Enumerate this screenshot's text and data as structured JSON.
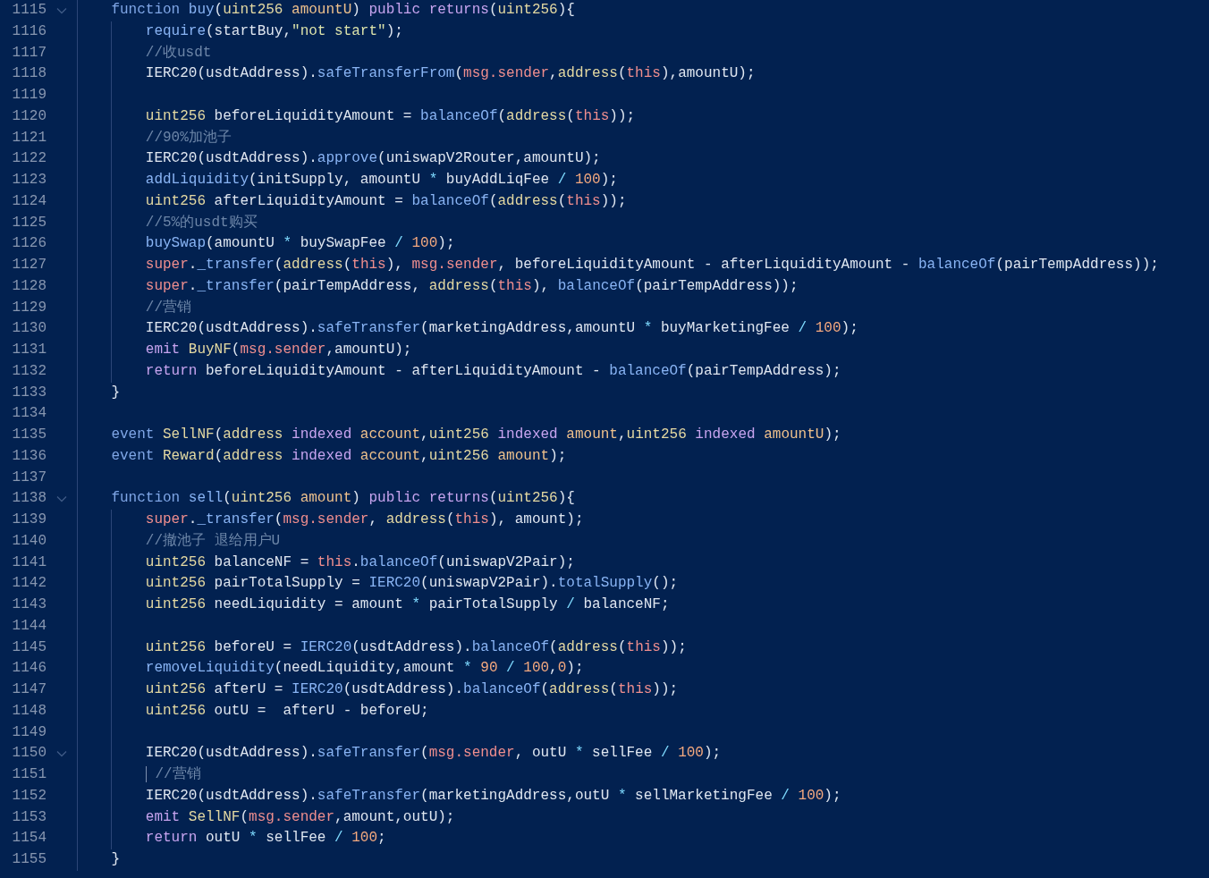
{
  "editor": {
    "lines": [
      {
        "number": "1115",
        "foldable": true,
        "tokens": [
          {
            "kind": "decl",
            "text": "function"
          },
          {
            "kind": "fn",
            "text": " buy"
          },
          {
            "kind": "plain",
            "text": "("
          },
          {
            "kind": "type",
            "text": "uint256"
          },
          {
            "kind": "param",
            "text": " amountU"
          },
          {
            "kind": "plain",
            "text": ") "
          },
          {
            "kind": "kw",
            "text": "public"
          },
          {
            "kind": "kw",
            "text": " returns"
          },
          {
            "kind": "plain",
            "text": "("
          },
          {
            "kind": "type",
            "text": "uint256"
          },
          {
            "kind": "plain",
            "text": "){"
          }
        ],
        "children": [
          {
            "number": "1116",
            "foldable": false,
            "tokens": [
              {
                "kind": "fn",
                "text": "require"
              },
              {
                "kind": "plain",
                "text": "(startBuy,"
              },
              {
                "kind": "str",
                "text": "\"not start\""
              },
              {
                "kind": "plain",
                "text": ");"
              }
            ]
          },
          {
            "number": "1117",
            "foldable": false,
            "tokens": [
              {
                "kind": "comment",
                "text": "//收usdt"
              }
            ]
          },
          {
            "number": "1118",
            "foldable": false,
            "tokens": [
              {
                "kind": "plain",
                "text": "IERC20(usdtAddress)."
              },
              {
                "kind": "fn",
                "text": "safeTransferFrom"
              },
              {
                "kind": "plain",
                "text": "("
              },
              {
                "kind": "self",
                "text": "msg.sender"
              },
              {
                "kind": "plain",
                "text": ","
              },
              {
                "kind": "type",
                "text": "address"
              },
              {
                "kind": "plain",
                "text": "("
              },
              {
                "kind": "self",
                "text": "this"
              },
              {
                "kind": "plain",
                "text": "),amountU);"
              }
            ]
          },
          {
            "number": "1119",
            "foldable": false
          },
          {
            "number": "1120",
            "foldable": false,
            "tokens": [
              {
                "kind": "type",
                "text": "uint256"
              },
              {
                "kind": "plain",
                "text": " beforeLiquidityAmount = "
              },
              {
                "kind": "fn",
                "text": "balanceOf"
              },
              {
                "kind": "plain",
                "text": "("
              },
              {
                "kind": "type",
                "text": "address"
              },
              {
                "kind": "plain",
                "text": "("
              },
              {
                "kind": "self",
                "text": "this"
              },
              {
                "kind": "plain",
                "text": "));"
              }
            ]
          },
          {
            "number": "1121",
            "foldable": false,
            "tokens": [
              {
                "kind": "comment",
                "text": "//90%加池子"
              }
            ]
          },
          {
            "number": "1122",
            "foldable": false,
            "tokens": [
              {
                "kind": "plain",
                "text": "IERC20(usdtAddress)."
              },
              {
                "kind": "fn",
                "text": "approve"
              },
              {
                "kind": "plain",
                "text": "(uniswapV2Router,amountU);"
              }
            ]
          },
          {
            "number": "1123",
            "foldable": false,
            "tokens": [
              {
                "kind": "fn",
                "text": "addLiquidity"
              },
              {
                "kind": "plain",
                "text": "(initSupply, amountU "
              },
              {
                "kind": "op",
                "text": "*"
              },
              {
                "kind": "plain",
                "text": " buyAddLiqFee "
              },
              {
                "kind": "op",
                "text": "/"
              },
              {
                "kind": "num",
                "text": " 100"
              },
              {
                "kind": "plain",
                "text": ");"
              }
            ]
          },
          {
            "number": "1124",
            "foldable": false,
            "tokens": [
              {
                "kind": "type",
                "text": "uint256"
              },
              {
                "kind": "plain",
                "text": " afterLiquidityAmount = "
              },
              {
                "kind": "fn",
                "text": "balanceOf"
              },
              {
                "kind": "plain",
                "text": "("
              },
              {
                "kind": "type",
                "text": "address"
              },
              {
                "kind": "plain",
                "text": "("
              },
              {
                "kind": "self",
                "text": "this"
              },
              {
                "kind": "plain",
                "text": "));"
              }
            ]
          },
          {
            "number": "1125",
            "foldable": false,
            "tokens": [
              {
                "kind": "comment",
                "text": "//5%的usdt购买"
              }
            ]
          },
          {
            "number": "1126",
            "foldable": false,
            "tokens": [
              {
                "kind": "fn",
                "text": "buySwap"
              },
              {
                "kind": "plain",
                "text": "(amountU "
              },
              {
                "kind": "op",
                "text": "*"
              },
              {
                "kind": "plain",
                "text": " buySwapFee "
              },
              {
                "kind": "op",
                "text": "/"
              },
              {
                "kind": "num",
                "text": " 100"
              },
              {
                "kind": "plain",
                "text": ");"
              }
            ]
          },
          {
            "number": "1127",
            "foldable": false,
            "tokens": [
              {
                "kind": "self",
                "text": "super"
              },
              {
                "kind": "plain",
                "text": "."
              },
              {
                "kind": "fn",
                "text": "_transfer"
              },
              {
                "kind": "plain",
                "text": "("
              },
              {
                "kind": "type",
                "text": "address"
              },
              {
                "kind": "plain",
                "text": "("
              },
              {
                "kind": "self",
                "text": "this"
              },
              {
                "kind": "plain",
                "text": "), "
              },
              {
                "kind": "self",
                "text": "msg.sender"
              },
              {
                "kind": "plain",
                "text": ", beforeLiquidityAmount - afterLiquidityAmount - "
              },
              {
                "kind": "fn",
                "text": "balanceOf"
              },
              {
                "kind": "plain",
                "text": "(pairTempAddress));"
              }
            ]
          },
          {
            "number": "1128",
            "foldable": false,
            "tokens": [
              {
                "kind": "self",
                "text": "super"
              },
              {
                "kind": "plain",
                "text": "."
              },
              {
                "kind": "fn",
                "text": "_transfer"
              },
              {
                "kind": "plain",
                "text": "(pairTempAddress, "
              },
              {
                "kind": "type",
                "text": "address"
              },
              {
                "kind": "plain",
                "text": "("
              },
              {
                "kind": "self",
                "text": "this"
              },
              {
                "kind": "plain",
                "text": "), "
              },
              {
                "kind": "fn",
                "text": "balanceOf"
              },
              {
                "kind": "plain",
                "text": "(pairTempAddress));"
              }
            ]
          },
          {
            "number": "1129",
            "foldable": false,
            "tokens": [
              {
                "kind": "comment",
                "text": "//营销"
              }
            ]
          },
          {
            "number": "1130",
            "foldable": false,
            "tokens": [
              {
                "kind": "plain",
                "text": "IERC20(usdtAddress)."
              },
              {
                "kind": "fn",
                "text": "safeTransfer"
              },
              {
                "kind": "plain",
                "text": "(marketingAddress,amountU "
              },
              {
                "kind": "op",
                "text": "*"
              },
              {
                "kind": "plain",
                "text": " buyMarketingFee "
              },
              {
                "kind": "op",
                "text": "/"
              },
              {
                "kind": "num",
                "text": " 100"
              },
              {
                "kind": "plain",
                "text": ");"
              }
            ]
          },
          {
            "number": "1131",
            "foldable": false,
            "tokens": [
              {
                "kind": "kw",
                "text": "emit"
              },
              {
                "kind": "type",
                "text": " BuyNF"
              },
              {
                "kind": "plain",
                "text": "("
              },
              {
                "kind": "self",
                "text": "msg.sender"
              },
              {
                "kind": "plain",
                "text": ",amountU);"
              }
            ]
          },
          {
            "number": "1132",
            "foldable": false,
            "tokens": [
              {
                "kind": "kw",
                "text": "return"
              },
              {
                "kind": "plain",
                "text": " beforeLiquidityAmount - afterLiquidityAmount - "
              },
              {
                "kind": "fn",
                "text": "balanceOf"
              },
              {
                "kind": "plain",
                "text": "(pairTempAddress);"
              }
            ]
          }
        ]
      },
      {
        "number": "1133",
        "foldable": false,
        "tokens": [
          {
            "kind": "plain",
            "text": "}"
          }
        ]
      },
      {
        "number": "1134",
        "foldable": false
      },
      {
        "number": "1135",
        "foldable": false,
        "tokens": [
          {
            "kind": "decl",
            "text": "event"
          },
          {
            "kind": "type",
            "text": " SellNF"
          },
          {
            "kind": "plain",
            "text": "("
          },
          {
            "kind": "type",
            "text": "address"
          },
          {
            "kind": "kw",
            "text": " indexed"
          },
          {
            "kind": "param",
            "text": " account"
          },
          {
            "kind": "plain",
            "text": ","
          },
          {
            "kind": "type",
            "text": "uint256"
          },
          {
            "kind": "kw",
            "text": " indexed"
          },
          {
            "kind": "param",
            "text": " amount"
          },
          {
            "kind": "plain",
            "text": ","
          },
          {
            "kind": "type",
            "text": "uint256"
          },
          {
            "kind": "kw",
            "text": " indexed"
          },
          {
            "kind": "param",
            "text": " amountU"
          },
          {
            "kind": "plain",
            "text": ");"
          }
        ]
      },
      {
        "number": "1136",
        "foldable": false,
        "tokens": [
          {
            "kind": "decl",
            "text": "event"
          },
          {
            "kind": "type",
            "text": " Reward"
          },
          {
            "kind": "plain",
            "text": "("
          },
          {
            "kind": "type",
            "text": "address"
          },
          {
            "kind": "kw",
            "text": " indexed"
          },
          {
            "kind": "param",
            "text": " account"
          },
          {
            "kind": "plain",
            "text": ","
          },
          {
            "kind": "type",
            "text": "uint256"
          },
          {
            "kind": "param",
            "text": " amount"
          },
          {
            "kind": "plain",
            "text": ");"
          }
        ]
      },
      {
        "number": "1137",
        "foldable": false
      },
      {
        "number": "1138",
        "foldable": true,
        "tokens": [
          {
            "kind": "decl",
            "text": "function"
          },
          {
            "kind": "fn",
            "text": " sell"
          },
          {
            "kind": "plain",
            "text": "("
          },
          {
            "kind": "type",
            "text": "uint256"
          },
          {
            "kind": "param",
            "text": " amount"
          },
          {
            "kind": "plain",
            "text": ") "
          },
          {
            "kind": "kw",
            "text": "public"
          },
          {
            "kind": "kw",
            "text": " returns"
          },
          {
            "kind": "plain",
            "text": "("
          },
          {
            "kind": "type",
            "text": "uint256"
          },
          {
            "kind": "plain",
            "text": "){"
          }
        ],
        "children": [
          {
            "number": "1139",
            "foldable": false,
            "tokens": [
              {
                "kind": "self",
                "text": "super"
              },
              {
                "kind": "plain",
                "text": "."
              },
              {
                "kind": "fn",
                "text": "_transfer"
              },
              {
                "kind": "plain",
                "text": "("
              },
              {
                "kind": "self",
                "text": "msg.sender"
              },
              {
                "kind": "plain",
                "text": ", "
              },
              {
                "kind": "type",
                "text": "address"
              },
              {
                "kind": "plain",
                "text": "("
              },
              {
                "kind": "self",
                "text": "this"
              },
              {
                "kind": "plain",
                "text": "), amount);"
              }
            ]
          },
          {
            "number": "1140",
            "foldable": false,
            "tokens": [
              {
                "kind": "comment",
                "text": "//撤池子 退给用户U"
              }
            ]
          },
          {
            "number": "1141",
            "foldable": false,
            "tokens": [
              {
                "kind": "type",
                "text": "uint256"
              },
              {
                "kind": "plain",
                "text": " balanceNF = "
              },
              {
                "kind": "self",
                "text": "this"
              },
              {
                "kind": "plain",
                "text": "."
              },
              {
                "kind": "fn",
                "text": "balanceOf"
              },
              {
                "kind": "plain",
                "text": "(uniswapV2Pair);"
              }
            ]
          },
          {
            "number": "1142",
            "foldable": false,
            "tokens": [
              {
                "kind": "type",
                "text": "uint256"
              },
              {
                "kind": "plain",
                "text": " pairTotalSupply = "
              },
              {
                "kind": "fn",
                "text": "IERC20"
              },
              {
                "kind": "plain",
                "text": "(uniswapV2Pair)."
              },
              {
                "kind": "fn",
                "text": "totalSupply"
              },
              {
                "kind": "plain",
                "text": "();"
              }
            ]
          },
          {
            "number": "1143",
            "foldable": false,
            "tokens": [
              {
                "kind": "type",
                "text": "uint256"
              },
              {
                "kind": "plain",
                "text": " needLiquidity = amount "
              },
              {
                "kind": "op",
                "text": "*"
              },
              {
                "kind": "plain",
                "text": " pairTotalSupply "
              },
              {
                "kind": "op",
                "text": "/"
              },
              {
                "kind": "plain",
                "text": " balanceNF;"
              }
            ]
          },
          {
            "number": "1144",
            "foldable": false
          },
          {
            "number": "1145",
            "foldable": false,
            "tokens": [
              {
                "kind": "type",
                "text": "uint256"
              },
              {
                "kind": "plain",
                "text": " beforeU = "
              },
              {
                "kind": "fn",
                "text": "IERC20"
              },
              {
                "kind": "plain",
                "text": "(usdtAddress)."
              },
              {
                "kind": "fn",
                "text": "balanceOf"
              },
              {
                "kind": "plain",
                "text": "("
              },
              {
                "kind": "type",
                "text": "address"
              },
              {
                "kind": "plain",
                "text": "("
              },
              {
                "kind": "self",
                "text": "this"
              },
              {
                "kind": "plain",
                "text": "));"
              }
            ]
          },
          {
            "number": "1146",
            "foldable": false,
            "tokens": [
              {
                "kind": "fn",
                "text": "removeLiquidity"
              },
              {
                "kind": "plain",
                "text": "(needLiquidity,amount "
              },
              {
                "kind": "op",
                "text": "*"
              },
              {
                "kind": "num",
                "text": " 90"
              },
              {
                "kind": "op",
                "text": " /"
              },
              {
                "kind": "num",
                "text": " 100"
              },
              {
                "kind": "plain",
                "text": ","
              },
              {
                "kind": "num",
                "text": "0"
              },
              {
                "kind": "plain",
                "text": ");"
              }
            ]
          },
          {
            "number": "1147",
            "foldable": false,
            "tokens": [
              {
                "kind": "type",
                "text": "uint256"
              },
              {
                "kind": "plain",
                "text": " afterU = "
              },
              {
                "kind": "fn",
                "text": "IERC20"
              },
              {
                "kind": "plain",
                "text": "(usdtAddress)."
              },
              {
                "kind": "fn",
                "text": "balanceOf"
              },
              {
                "kind": "plain",
                "text": "("
              },
              {
                "kind": "type",
                "text": "address"
              },
              {
                "kind": "plain",
                "text": "("
              },
              {
                "kind": "self",
                "text": "this"
              },
              {
                "kind": "plain",
                "text": "));"
              }
            ]
          },
          {
            "number": "1148",
            "foldable": false,
            "tokens": [
              {
                "kind": "type",
                "text": "uint256"
              },
              {
                "kind": "plain",
                "text": " outU =  afterU - beforeU;"
              }
            ]
          },
          {
            "number": "1149",
            "foldable": false
          },
          {
            "number": "1150",
            "foldable": true,
            "tokens": [
              {
                "kind": "plain",
                "text": "IERC20(usdtAddress)."
              },
              {
                "kind": "fn",
                "text": "safeTransfer"
              },
              {
                "kind": "plain",
                "text": "("
              },
              {
                "kind": "self",
                "text": "msg.sender"
              },
              {
                "kind": "plain",
                "text": ", outU "
              },
              {
                "kind": "op",
                "text": "*"
              },
              {
                "kind": "plain",
                "text": " sellFee "
              },
              {
                "kind": "op",
                "text": "/"
              },
              {
                "kind": "num",
                "text": " 100"
              },
              {
                "kind": "plain",
                "text": ");"
              }
            ]
          },
          {
            "number": "1151",
            "foldable": false,
            "tokens": [
              {
                "kind": "caret"
              },
              {
                "kind": "comment",
                "text": " //营销"
              }
            ]
          },
          {
            "number": "1152",
            "foldable": false,
            "tokens": [
              {
                "kind": "plain",
                "text": "IERC20(usdtAddress)."
              },
              {
                "kind": "fn",
                "text": "safeTransfer"
              },
              {
                "kind": "plain",
                "text": "(marketingAddress,outU "
              },
              {
                "kind": "op",
                "text": "*"
              },
              {
                "kind": "plain",
                "text": " sellMarketingFee "
              },
              {
                "kind": "op",
                "text": "/"
              },
              {
                "kind": "num",
                "text": " 100"
              },
              {
                "kind": "plain",
                "text": ");"
              }
            ]
          },
          {
            "number": "1153",
            "foldable": false,
            "tokens": [
              {
                "kind": "kw",
                "text": "emit"
              },
              {
                "kind": "type",
                "text": " SellNF"
              },
              {
                "kind": "plain",
                "text": "("
              },
              {
                "kind": "self",
                "text": "msg.sender"
              },
              {
                "kind": "plain",
                "text": ",amount,outU);"
              }
            ]
          },
          {
            "number": "1154",
            "foldable": false,
            "tokens": [
              {
                "kind": "kw",
                "text": "return"
              },
              {
                "kind": "plain",
                "text": " outU "
              },
              {
                "kind": "op",
                "text": "*"
              },
              {
                "kind": "plain",
                "text": " sellFee "
              },
              {
                "kind": "op",
                "text": "/"
              },
              {
                "kind": "num",
                "text": " 100"
              },
              {
                "kind": "plain",
                "text": ";"
              }
            ]
          }
        ]
      },
      {
        "number": "1155",
        "foldable": false,
        "tokens": [
          {
            "kind": "plain",
            "text": "}"
          }
        ]
      }
    ]
  }
}
